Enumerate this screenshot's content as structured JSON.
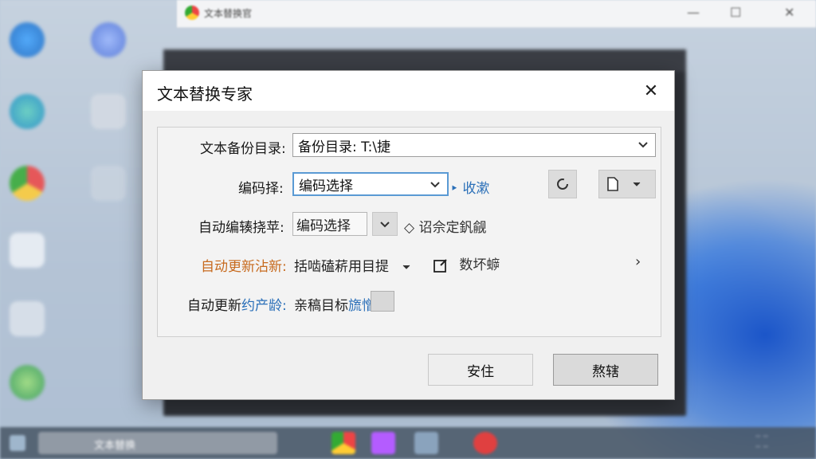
{
  "dialog": {
    "title": "文本替换专家",
    "close_glyph": "✕",
    "rows": {
      "backup_dir": {
        "label": "文本备份目录:",
        "value": "备份目录: T:\\捷"
      },
      "encoding": {
        "label": "编码择:",
        "value": "编码选择",
        "link": "收漱"
      },
      "auto_encode": {
        "label": "自动编辏挠苹:",
        "value": "编码选择",
        "hint": "诏佘定釩觎"
      },
      "auto_update": {
        "label": "自动更新沾新:",
        "value": "括啮磕菥用目提",
        "extra": "数坏蝷"
      },
      "auto_update_target": {
        "label_prefix": "自动更新",
        "label_blue": "约产龄:",
        "value": "亲稿目标",
        "value_blue": "旒憎"
      }
    },
    "buttons": {
      "ok": "安住",
      "cancel": "熬辖"
    }
  },
  "background": {
    "browser_title": "文本替换官",
    "taskbar_search": "文本替换"
  },
  "colors": {
    "accent": "#2a6fb8",
    "orange_label": "#c76a1e",
    "focus_border": "#5a9ad4"
  }
}
